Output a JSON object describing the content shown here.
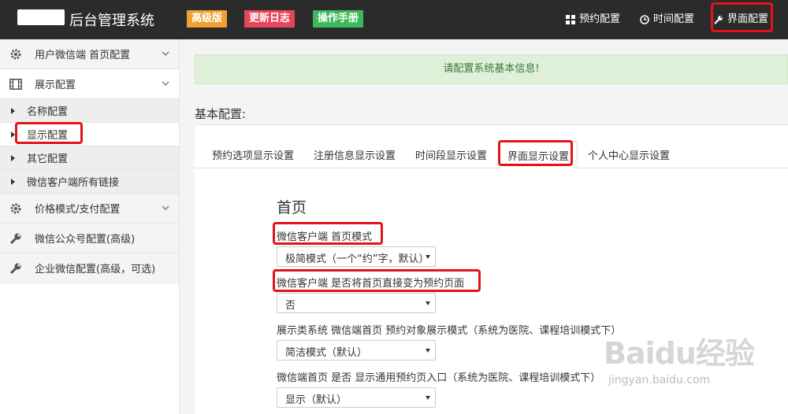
{
  "header": {
    "brand": "后台管理系统",
    "badges": [
      "高级版",
      "更新日志",
      "操作手册"
    ],
    "nav": [
      "预约配置",
      "时间配置",
      "界面配置"
    ]
  },
  "sidebar": {
    "groups": [
      {
        "label": "用户微信端 首页配置",
        "icon": "gear-icon"
      },
      {
        "label": "展示配置",
        "icon": "film-icon"
      },
      {
        "label": "价格模式/支付配置",
        "icon": "gear-icon"
      },
      {
        "label": "微信公众号配置(高级)",
        "icon": "wrench-icon"
      },
      {
        "label": "企业微信配置(高级，可选)",
        "icon": "wrench-icon"
      }
    ],
    "subitems": [
      "名称配置",
      "显示配置",
      "其它配置",
      "微信客户端所有链接"
    ]
  },
  "main": {
    "alert": "请配置系统基本信息!",
    "section_title": "基本配置:",
    "tabs": [
      "预约选项显示设置",
      "注册信息显示设置",
      "时间段显示设置",
      "界面显示设置",
      "个人中心显示设置"
    ],
    "content_title": "首页",
    "fields": [
      {
        "label": "微信客户端 首页模式",
        "value": "极简模式（一个“约”字，默认）"
      },
      {
        "label": "微信客户端 是否将首页直接变为预约页面",
        "value": "否"
      },
      {
        "label": "展示类系统 微信端首页 预约对象展示模式（系统为医院、课程培训模式下）",
        "value": "简洁模式（默认）"
      },
      {
        "label": "微信端首页 是否 显示通用预约页入口（系统为医院、课程培训模式下）",
        "value": "显示（默认）"
      }
    ]
  },
  "watermark": {
    "logo": "Baidu经验",
    "url": "jingyan.baidu.com"
  },
  "colors": {
    "header_bg": "#2b2b2b",
    "badge_orange": "#f0a030",
    "badge_red": "#e8455a",
    "badge_green": "#3cb95a",
    "alert_bg": "#dff0d8",
    "highlight": "#e0141a"
  }
}
